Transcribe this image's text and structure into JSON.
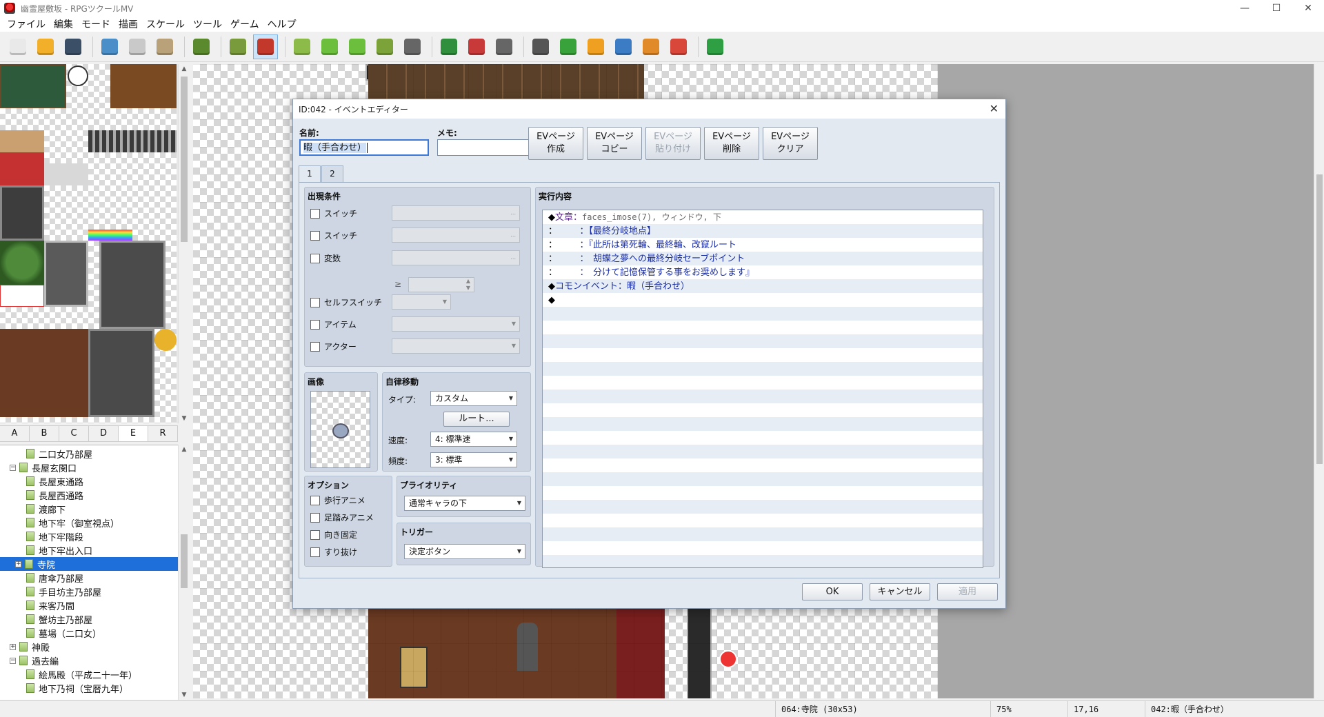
{
  "window": {
    "title": "幽霊屋敷坂 - RPGツクールMV",
    "minimize": "—",
    "maximize": "☐",
    "close": "✕"
  },
  "menu": [
    "ファイル",
    "編集",
    "モード",
    "描画",
    "スケール",
    "ツール",
    "ゲーム",
    "ヘルプ"
  ],
  "toolbar": [
    {
      "icon": "new-project-icon",
      "color": "#e9e9e9"
    },
    {
      "icon": "open-folder-icon",
      "color": "#f2b02a"
    },
    {
      "icon": "save-icon",
      "color": "#3b4f66"
    },
    {
      "sep": true
    },
    {
      "icon": "cut-icon",
      "color": "#4b8fc8"
    },
    {
      "icon": "copy-icon",
      "color": "#c9c9c9"
    },
    {
      "icon": "paste-icon",
      "color": "#b9a27a"
    },
    {
      "sep": true
    },
    {
      "icon": "undo-icon",
      "color": "#5a8a2d"
    },
    {
      "sep": true
    },
    {
      "icon": "map-mode-icon",
      "color": "#7a9b3c"
    },
    {
      "icon": "event-mode-icon",
      "color": "#c2392b",
      "active": true
    },
    {
      "sep": true
    },
    {
      "icon": "pencil-icon",
      "color": "#8dbb4a"
    },
    {
      "icon": "rectangle-icon",
      "color": "#6bbf3c"
    },
    {
      "icon": "ellipse-icon",
      "color": "#6bbf3c"
    },
    {
      "icon": "flood-fill-icon",
      "color": "#7ba33a"
    },
    {
      "icon": "shadow-pen-icon",
      "color": "#666666"
    },
    {
      "sep": true
    },
    {
      "icon": "zoom-in-icon",
      "color": "#2f8f3c"
    },
    {
      "icon": "zoom-out-icon",
      "color": "#c83a3a"
    },
    {
      "icon": "zoom-actual-icon",
      "color": "#666666"
    },
    {
      "sep": true
    },
    {
      "icon": "database-icon",
      "color": "#555555"
    },
    {
      "icon": "plugin-manager-icon",
      "color": "#3aa23a"
    },
    {
      "icon": "sound-test-icon",
      "color": "#f0a020"
    },
    {
      "icon": "event-search-icon",
      "color": "#3b7cc5"
    },
    {
      "icon": "resource-manager-icon",
      "color": "#e08a2a"
    },
    {
      "icon": "character-generator-icon",
      "color": "#d9463a"
    },
    {
      "sep": true
    },
    {
      "icon": "playtest-icon",
      "color": "#2ea043"
    }
  ],
  "tile_tabs": [
    "A",
    "B",
    "C",
    "D",
    "E",
    "R"
  ],
  "tile_tab_selected": "E",
  "map_tree": [
    {
      "label": "二口女乃部屋",
      "indent": 2,
      "expander": ""
    },
    {
      "label": "長屋玄関口",
      "indent": 1,
      "expander": "−"
    },
    {
      "label": "長屋東通路",
      "indent": 2,
      "expander": ""
    },
    {
      "label": "長屋西通路",
      "indent": 2,
      "expander": ""
    },
    {
      "label": "渡廊下",
      "indent": 2,
      "expander": ""
    },
    {
      "label": "地下牢（御室視点）",
      "indent": 2,
      "expander": ""
    },
    {
      "label": "地下牢階段",
      "indent": 2,
      "expander": ""
    },
    {
      "label": "地下牢出入口",
      "indent": 2,
      "expander": ""
    },
    {
      "label": "寺院",
      "indent": 2,
      "expander": "+",
      "selected": true
    },
    {
      "label": "唐傘乃部屋",
      "indent": 2,
      "expander": ""
    },
    {
      "label": "手目坊主乃部屋",
      "indent": 2,
      "expander": ""
    },
    {
      "label": "来客乃間",
      "indent": 2,
      "expander": ""
    },
    {
      "label": "蟹坊主乃部屋",
      "indent": 2,
      "expander": ""
    },
    {
      "label": "墓場（二口女）",
      "indent": 2,
      "expander": ""
    },
    {
      "label": "神殿",
      "indent": 1,
      "expander": "+"
    },
    {
      "label": "過去編",
      "indent": 1,
      "expander": "−"
    },
    {
      "label": "絵馬殿（平成二十一年）",
      "indent": 2,
      "expander": ""
    },
    {
      "label": "地下乃祠（宝暦九年）",
      "indent": 2,
      "expander": ""
    }
  ],
  "status": {
    "map": "064:寺院 (30x53)",
    "zoom": "75%",
    "coords": "17,16",
    "event": "042:暇（手合わせ）"
  },
  "dialog": {
    "title": "ID:042 - イベントエディター",
    "close": "✕",
    "name_label": "名前:",
    "name_value": "暇（手合わせ）",
    "memo_label": "メモ:",
    "memo_value": "",
    "ev_buttons": [
      {
        "line1": "EVページ",
        "line2": "作成",
        "disabled": false
      },
      {
        "line1": "EVページ",
        "line2": "コピー",
        "disabled": false
      },
      {
        "line1": "EVページ",
        "line2": "貼り付け",
        "disabled": true
      },
      {
        "line1": "EVページ",
        "line2": "削除",
        "disabled": false
      },
      {
        "line1": "EVページ",
        "line2": "クリア",
        "disabled": false
      }
    ],
    "page_tabs": [
      "1",
      "2"
    ],
    "conditions": {
      "title": "出現条件",
      "rows": [
        {
          "label": "スイッチ",
          "kind": "dots",
          "value": "..."
        },
        {
          "label": "スイッチ",
          "kind": "dots",
          "value": "..."
        },
        {
          "label": "変数",
          "kind": "dots",
          "value": "..."
        },
        {
          "label": "セルフスイッチ",
          "kind": "smallcombo",
          "value": ""
        },
        {
          "label": "アイテム",
          "kind": "combo",
          "value": ""
        },
        {
          "label": "アクター",
          "kind": "combo",
          "value": ""
        }
      ],
      "gte": "≥"
    },
    "image": {
      "title": "画像"
    },
    "autonomous": {
      "title": "自律移動",
      "type_label": "タイプ:",
      "type_value": "カスタム",
      "route_button": "ルート...",
      "speed_label": "速度:",
      "speed_value": "4: 標準速",
      "freq_label": "頻度:",
      "freq_value": "3: 標準"
    },
    "options": {
      "title": "オプション",
      "items": [
        "歩行アニメ",
        "足踏みアニメ",
        "向き固定",
        "すり抜け"
      ]
    },
    "priority": {
      "title": "プライオリティ",
      "value": "通常キャラの下"
    },
    "trigger": {
      "title": "トリガー",
      "value": "決定ボタン"
    },
    "contents": {
      "title": "実行内容",
      "lines": [
        {
          "sym": "◆",
          "kw": "文章：",
          "p": "faces_imose(7), ウィンドウ, 下",
          "t": ""
        },
        {
          "sym": "：",
          "kw": "",
          "p": "",
          "t": "　　　：【最終分岐地点】"
        },
        {
          "sym": "：",
          "kw": "",
          "p": "",
          "t": "　　　：『此所は第死輪、最終輪、改竄ルート"
        },
        {
          "sym": "：",
          "kw": "",
          "p": "",
          "t": "　　　：　胡蝶之夢への最終分岐セーブポイント"
        },
        {
          "sym": "：",
          "kw": "",
          "p": "",
          "t": "　　　：　分けて記憶保管する事をお奨めします』"
        },
        {
          "sym": "◆",
          "kw": "",
          "p": "",
          "t": "コモンイベント：暇（手合わせ）"
        },
        {
          "sym": "◆",
          "kw": "",
          "p": "",
          "t": ""
        }
      ]
    },
    "ok": "OK",
    "cancel": "キャンセル",
    "apply": "適用"
  }
}
